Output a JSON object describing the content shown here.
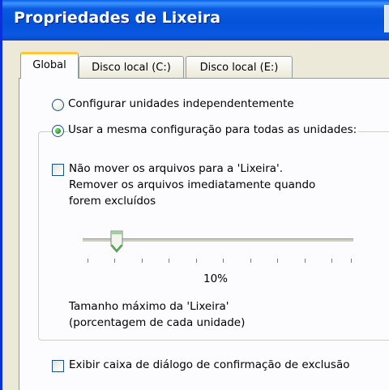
{
  "window": {
    "title": "Propriedades de Lixeira"
  },
  "tabs": [
    {
      "label": "Global",
      "active": true
    },
    {
      "label": "Disco local (C:)",
      "active": false
    },
    {
      "label": "Disco local (E:)",
      "active": false
    }
  ],
  "options": {
    "radio_independent": "Configurar unidades independentemente",
    "radio_independent_selected": false,
    "radio_same": "Usar a mesma configuração para todas as unidades:",
    "radio_same_selected": true,
    "no_move_line1": "Não mover os arquivos para a 'Lixeira'.",
    "no_move_line2": "Remover os arquivos imediatamente quando",
    "no_move_line3": "forem excluídos",
    "no_move_checked": false,
    "slider_value_label": "10%",
    "slider_value_fraction": 0.1,
    "max_size_line1": "Tamanho máximo da 'Lixeira'",
    "max_size_line2": "(porcentagem de cada unidade)",
    "confirm_dialog": "Exibir caixa de diálogo de confirmação de exclusão",
    "confirm_dialog_checked": false
  },
  "colors": {
    "titlebar": "#0452d8",
    "active_tab_highlight": "#ffc83c",
    "radio_dot": "#219321"
  }
}
